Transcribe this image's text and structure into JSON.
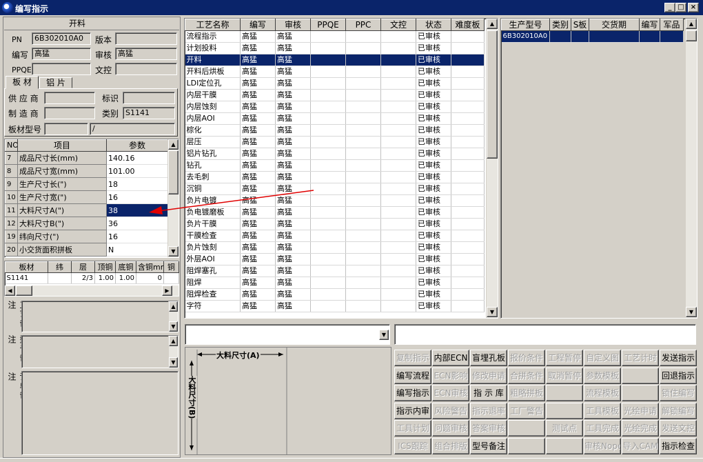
{
  "window": {
    "title": "编写指示",
    "minimize": "_",
    "maximize": "□",
    "close": "×"
  },
  "header_panel": {
    "title": "开料",
    "pn_label": "PN",
    "pn_value": "6B302010A0",
    "version_label": "版本",
    "version_value": "",
    "author_label": "编写",
    "author_value": "高猛",
    "review_label": "审核",
    "review_value": "高猛",
    "ppqe_label": "PPQE",
    "ppqe_value": "",
    "dc_label": "文控",
    "dc_value": ""
  },
  "material_tabs": {
    "tab1": "板 材",
    "tab2": "铝 片"
  },
  "material_panel": {
    "supplier_label": "供 应 商",
    "supplier_value": "",
    "mark_label": "标识",
    "mark_value": "",
    "maker_label": "制 造 商",
    "maker_value": "",
    "category_label": "类别",
    "category_value": "S1141",
    "model_label": "板材型号",
    "model_value": "",
    "model_value2": "/"
  },
  "param_table": {
    "headers": [
      "NO",
      "项目",
      "参数"
    ],
    "rows": [
      {
        "no": "7",
        "item": "成品尺寸长(mm)",
        "value": "140.16"
      },
      {
        "no": "8",
        "item": "成品尺寸宽(mm)",
        "value": "101.00"
      },
      {
        "no": "9",
        "item": "生产尺寸长(\")",
        "value": "18"
      },
      {
        "no": "10",
        "item": "生产尺寸宽(\")",
        "value": "16"
      },
      {
        "no": "11",
        "item": "大料尺寸A(\")",
        "value": "38"
      },
      {
        "no": "12",
        "item": "大料尺寸B(\")",
        "value": "36"
      },
      {
        "no": "19",
        "item": "纬向尺寸(\")",
        "value": "16"
      },
      {
        "no": "20",
        "item": "小交货面积拼板",
        "value": "N"
      }
    ]
  },
  "board_table": {
    "headers": [
      "板材",
      "纬",
      "层",
      "顶铜",
      "底铜",
      "含铜mm",
      "铜"
    ],
    "rows": [
      {
        "material": "S1141",
        "weft": "",
        "layer": "2/3",
        "top": "1.00",
        "bottom": "1.00",
        "cu": "0",
        "x": ""
      }
    ]
  },
  "notes": {
    "process": "工艺备注",
    "model": "型号备注",
    "order": "订单备注"
  },
  "process_table": {
    "headers": [
      "工艺名称",
      "编写",
      "审核",
      "PPQE",
      "PPC",
      "文控",
      "状态",
      "难度板"
    ],
    "rows": [
      {
        "name": "流程指示",
        "author": "高猛",
        "review": "高猛",
        "status": "已审核"
      },
      {
        "name": "计划投料",
        "author": "高猛",
        "review": "高猛",
        "status": "已审核"
      },
      {
        "name": "开料",
        "author": "高猛",
        "review": "高猛",
        "status": "已审核"
      },
      {
        "name": "开料后烘板",
        "author": "高猛",
        "review": "高猛",
        "status": "已审核"
      },
      {
        "name": "LDI定位孔",
        "author": "高猛",
        "review": "高猛",
        "status": "已审核"
      },
      {
        "name": "内层干膜",
        "author": "高猛",
        "review": "高猛",
        "status": "已审核"
      },
      {
        "name": "内层蚀刻",
        "author": "高猛",
        "review": "高猛",
        "status": "已审核"
      },
      {
        "name": "内层AOI",
        "author": "高猛",
        "review": "高猛",
        "status": "已审核"
      },
      {
        "name": "棕化",
        "author": "高猛",
        "review": "高猛",
        "status": "已审核"
      },
      {
        "name": "层压",
        "author": "高猛",
        "review": "高猛",
        "status": "已审核"
      },
      {
        "name": "铝片钻孔",
        "author": "高猛",
        "review": "高猛",
        "status": "已审核"
      },
      {
        "name": "钻孔",
        "author": "高猛",
        "review": "高猛",
        "status": "已审核"
      },
      {
        "name": "去毛刺",
        "author": "高猛",
        "review": "高猛",
        "status": "已审核"
      },
      {
        "name": "沉铜",
        "author": "高猛",
        "review": "高猛",
        "status": "已审核"
      },
      {
        "name": "负片电镀",
        "author": "高猛",
        "review": "高猛",
        "status": "已审核"
      },
      {
        "name": "负电镀磨板",
        "author": "高猛",
        "review": "高猛",
        "status": "已审核"
      },
      {
        "name": "负片干膜",
        "author": "高猛",
        "review": "高猛",
        "status": "已审核"
      },
      {
        "name": "干膜检查",
        "author": "高猛",
        "review": "高猛",
        "status": "已审核"
      },
      {
        "name": "负片蚀刻",
        "author": "高猛",
        "review": "高猛",
        "status": "已审核"
      },
      {
        "name": "外层AOI",
        "author": "高猛",
        "review": "高猛",
        "status": "已审核"
      },
      {
        "name": "阻焊塞孔",
        "author": "高猛",
        "review": "高猛",
        "status": "已审核"
      },
      {
        "name": "阻焊",
        "author": "高猛",
        "review": "高猛",
        "status": "已审核"
      },
      {
        "name": "阻焊检查",
        "author": "高猛",
        "review": "高猛",
        "status": "已审核"
      },
      {
        "name": "字符",
        "author": "高猛",
        "review": "高猛",
        "status": "已审核"
      }
    ]
  },
  "production_table": {
    "headers": [
      "生产型号",
      "类别",
      "S板",
      "交货期",
      "编写",
      "军品"
    ],
    "rows": [
      {
        "model": "6B302010A0"
      }
    ]
  },
  "diagram": {
    "a_label": "大料尺寸(A)",
    "b_label": "大料尺寸(B)"
  },
  "buttons": [
    [
      {
        "label": "复制指示",
        "enabled": false
      },
      {
        "label": "内部ECN",
        "enabled": true
      },
      {
        "label": "盲埋孔板",
        "enabled": true
      },
      {
        "label": "报价条件",
        "enabled": false
      },
      {
        "label": "工程暂停",
        "enabled": false
      },
      {
        "label": "自定义图",
        "enabled": false
      },
      {
        "label": "工艺计时",
        "enabled": false
      },
      {
        "label": "发送指示",
        "enabled": true
      }
    ],
    [
      {
        "label": "编写流程",
        "enabled": true
      },
      {
        "label": "ECN影响",
        "enabled": false
      },
      {
        "label": "修改申请",
        "enabled": false
      },
      {
        "label": "合拼条件",
        "enabled": false
      },
      {
        "label": "取消暂停",
        "enabled": false
      },
      {
        "label": "参数模板",
        "enabled": false
      },
      {
        "label": "",
        "enabled": false
      },
      {
        "label": "回退指示",
        "enabled": true
      }
    ],
    [
      {
        "label": "编写指示",
        "enabled": true
      },
      {
        "label": "ECN审核",
        "enabled": false
      },
      {
        "label": "指 示 库",
        "enabled": true
      },
      {
        "label": "粗略拼板",
        "enabled": false
      },
      {
        "label": "",
        "enabled": false
      },
      {
        "label": "流程模板",
        "enabled": false
      },
      {
        "label": "",
        "enabled": false
      },
      {
        "label": "锁住编写",
        "enabled": false
      }
    ],
    [
      {
        "label": "指示内审",
        "enabled": true
      },
      {
        "label": "风险警告",
        "enabled": false
      },
      {
        "label": "指示退率",
        "enabled": false
      },
      {
        "label": "工厂警告",
        "enabled": false
      },
      {
        "label": "",
        "enabled": false
      },
      {
        "label": "工具模板",
        "enabled": false
      },
      {
        "label": "光绘申请",
        "enabled": false
      },
      {
        "label": "解锁编写",
        "enabled": false
      }
    ],
    [
      {
        "label": "工具计划",
        "enabled": false
      },
      {
        "label": "问题审核",
        "enabled": false
      },
      {
        "label": "答案审核",
        "enabled": false
      },
      {
        "label": "",
        "enabled": false
      },
      {
        "label": "测试点",
        "enabled": false
      },
      {
        "label": "工具完成",
        "enabled": false
      },
      {
        "label": "光绘完成",
        "enabled": false
      },
      {
        "label": "发送文控",
        "enabled": false
      }
    ],
    [
      {
        "label": "ICS跟踪",
        "enabled": false
      },
      {
        "label": "组合排版",
        "enabled": false
      },
      {
        "label": "型号备注",
        "enabled": true
      },
      {
        "label": "",
        "enabled": false
      },
      {
        "label": "",
        "enabled": false
      },
      {
        "label": "审核Nope",
        "enabled": false
      },
      {
        "label": "导入CAM",
        "enabled": false
      },
      {
        "label": "指示检查",
        "enabled": true
      }
    ]
  ],
  "colors": {
    "titlebar": "#0a246a",
    "selection": "#0a246a",
    "arrow": "#e00000",
    "face": "#d4d0c8"
  }
}
